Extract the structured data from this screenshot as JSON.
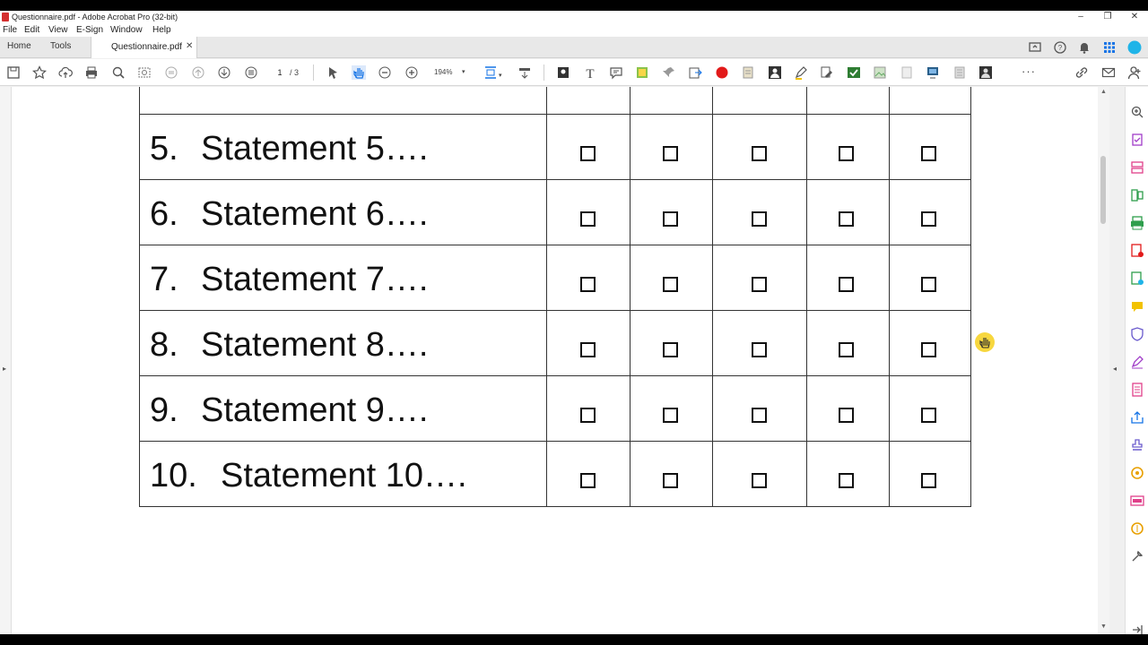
{
  "window": {
    "title": "Questionnaire.pdf - Adobe Acrobat Pro (32-bit)",
    "minimize": "–",
    "restore": "❐",
    "close": "✕"
  },
  "menu": [
    "File",
    "Edit",
    "View",
    "E-Sign",
    "Window",
    "Help"
  ],
  "tabs": {
    "home": "Home",
    "tools": "Tools",
    "document": "Questionnaire.pdf",
    "close": "✕"
  },
  "toolbar": {
    "current_page": "1",
    "total_pages": "/ 3",
    "zoom": "194%",
    "zoom_arrow": "▾",
    "more": "···"
  },
  "statements": [
    {
      "num": "5.",
      "text": "Statement 5…."
    },
    {
      "num": "6.",
      "text": "Statement 6…."
    },
    {
      "num": "7.",
      "text": "Statement 7…."
    },
    {
      "num": "8.",
      "text": "Statement 8…."
    },
    {
      "num": "9.",
      "text": "Statement 9…."
    },
    {
      "num": "10.",
      "text": "Statement 10…."
    }
  ],
  "colors": {
    "accent_blue": "#1473e6",
    "record_red": "#e21a1a",
    "cursor_yellow": "#f7d534"
  }
}
